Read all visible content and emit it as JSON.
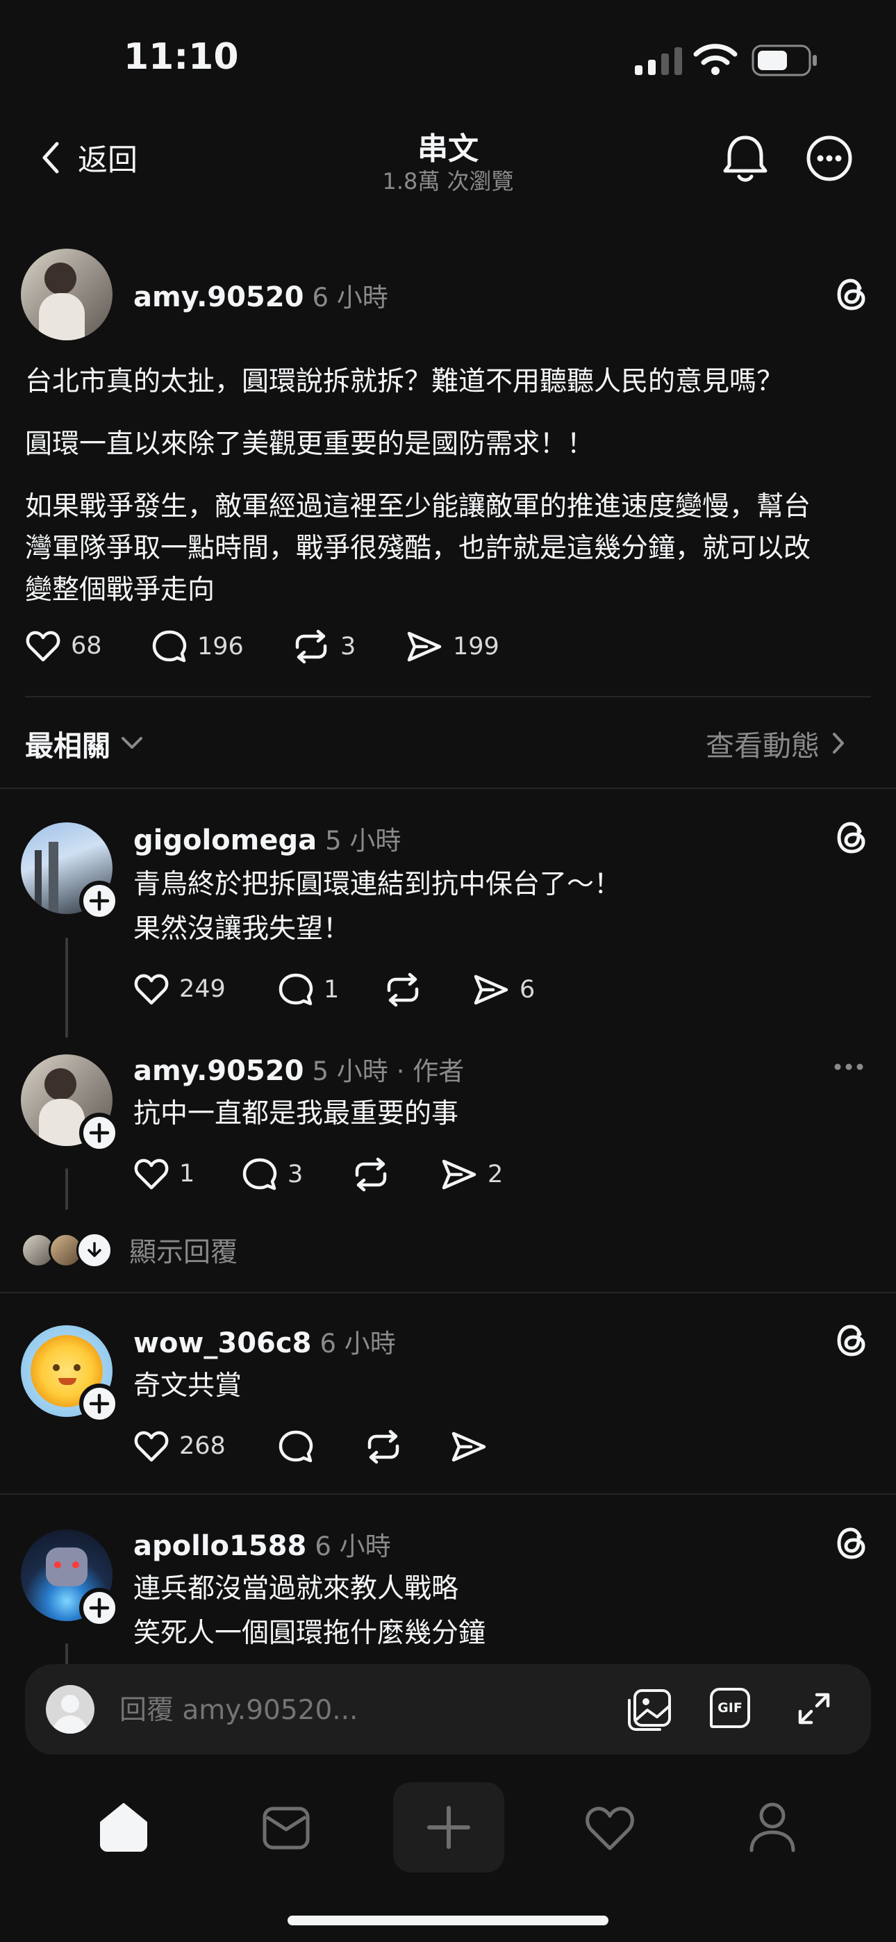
{
  "status": {
    "time": "11:10"
  },
  "header": {
    "back": "返回",
    "title": "串文",
    "subtitle": "1.8萬 次瀏覽"
  },
  "post": {
    "user": "amy.90520",
    "time": "6 小時",
    "p1": "台北市真的太扯，圓環說拆就拆？難道不用聽聽人民的意見嗎？",
    "p2": "圓環一直以來除了美觀更重要的是國防需求！！",
    "p3a": "如果戰爭發生，敵軍經過這裡至少能讓敵軍的推進速度變慢，幫台",
    "p3b": "灣軍隊爭取一點時間，戰爭很殘酷，也許就是這幾分鐘，就可以改",
    "p3c": "變整個戰爭走向",
    "likes": "68",
    "comments": "196",
    "reposts": "3",
    "shares": "199"
  },
  "sort": {
    "label": "最相關",
    "activity": "查看動態"
  },
  "replies": [
    {
      "user": "gigolomega",
      "time": "5 小時",
      "line1": "青鳥終於把拆圓環連結到抗中保台了～！",
      "line2": "果然沒讓我失望！",
      "likes": "249",
      "comments": "1",
      "shares": "6"
    },
    {
      "user": "amy.90520",
      "time": "5 小時",
      "author_tag": "· 作者",
      "line1": "抗中一直都是我最重要的事",
      "likes": "1",
      "comments": "3",
      "shares": "2"
    },
    {
      "user": "wow_306c8",
      "time": "6 小時",
      "line1": "奇文共賞",
      "likes": "268"
    },
    {
      "user": "apollo1588",
      "time": "6 小時",
      "line1": "連兵都沒當過就來教人戰略",
      "line2": "笑死人一個圓環拖什麼幾分鐘"
    }
  ],
  "show_replies": "顯示回覆",
  "composer": {
    "placeholder": "回覆 amy.90520...",
    "gif": "GIF"
  },
  "colors": {
    "background": "#101010",
    "text": "#f3f5f7",
    "muted": "#8a8a8a",
    "divider": "#262626"
  }
}
